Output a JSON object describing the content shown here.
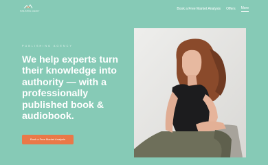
{
  "header": {
    "logo_text": "PUBLISHING AGENCY",
    "nav": [
      {
        "label": "Book a Free Market Analysis"
      },
      {
        "label": "Offers"
      },
      {
        "label": "More"
      }
    ]
  },
  "hero": {
    "eyebrow": "PUBLISHING AGENCY",
    "headline": "We help experts turn their knowledge into authority — with a professionally published book & audiobook.",
    "cta_label": "Book a Free Market Analysis"
  },
  "colors": {
    "background": "#86cab6",
    "accent": "#ea7848",
    "text": "#ffffff"
  }
}
